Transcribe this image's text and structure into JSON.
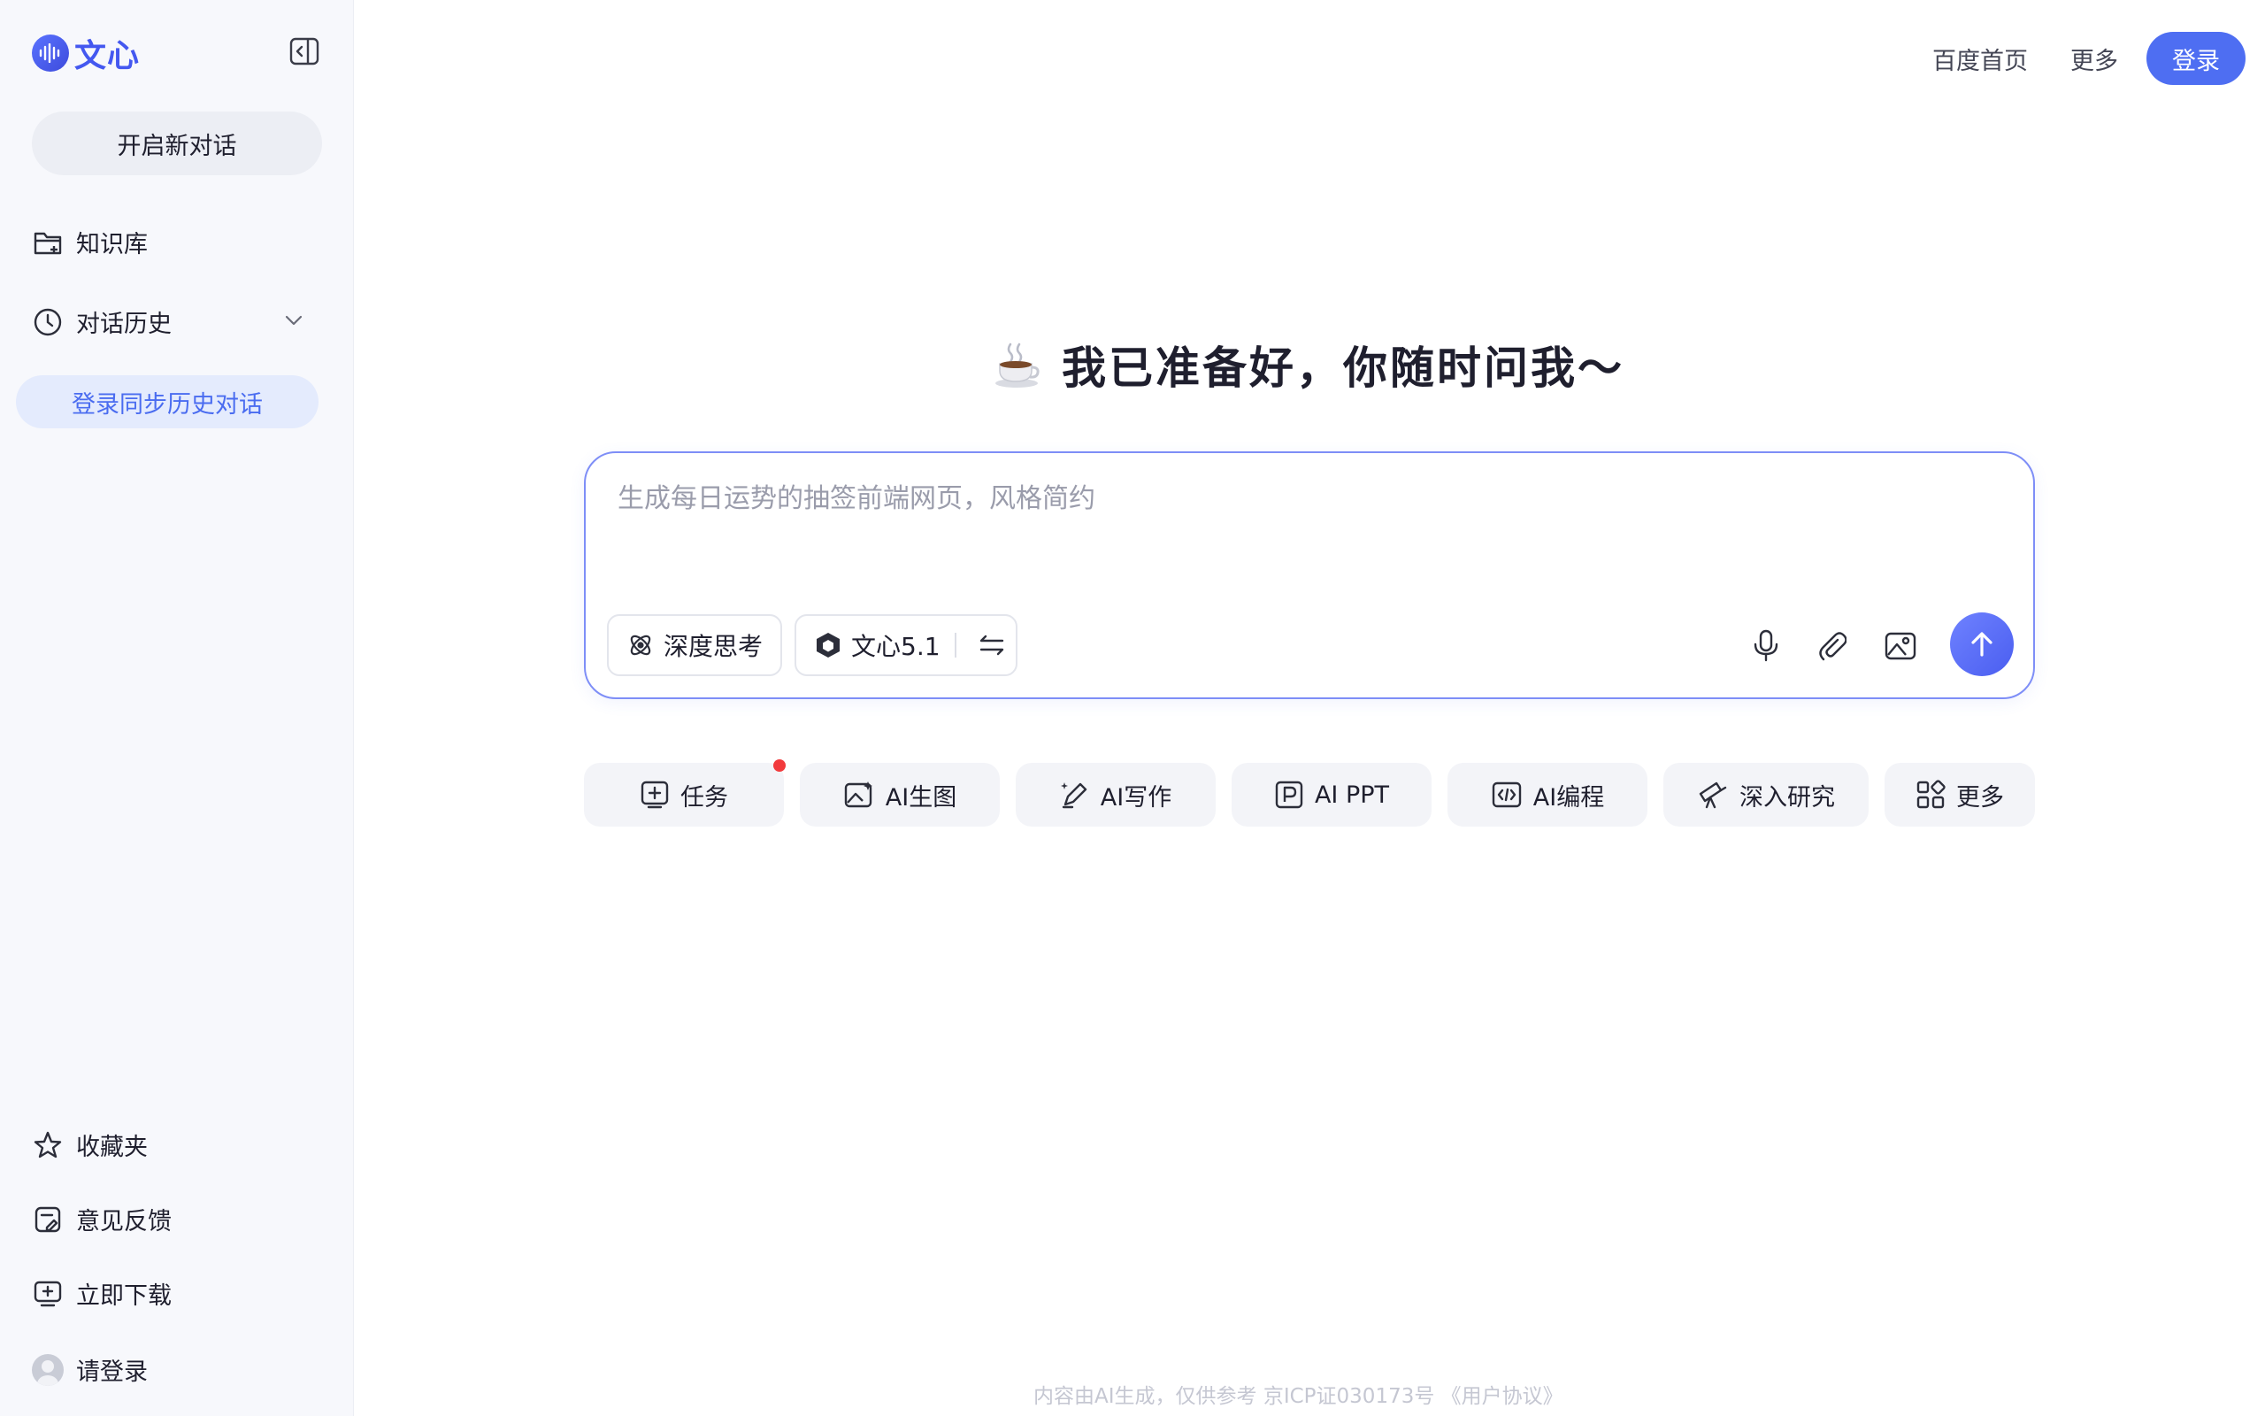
{
  "brand": {
    "logo_text": "文心",
    "accent": "#4e6ef2"
  },
  "sidebar": {
    "new_chat_label": "开启新对话",
    "knowledge_label": "知识库",
    "history_label": "对话历史",
    "login_sync_label": "登录同步历史对话",
    "favorites_label": "收藏夹",
    "feedback_label": "意见反馈",
    "download_label": "立即下载",
    "login_label": "请登录"
  },
  "header": {
    "baidu_home": "百度首页",
    "more": "更多",
    "login": "登录"
  },
  "main": {
    "greeting": "我已准备好，你随时问我～",
    "input_placeholder": "生成每日运势的抽签前端网页，风格简约",
    "deep_think_label": "深度思考",
    "model_label": "文心5.1",
    "chips": [
      {
        "label": "任务",
        "icon": "task-icon"
      },
      {
        "label": "AI生图",
        "icon": "image-gen-icon"
      },
      {
        "label": "AI写作",
        "icon": "pen-icon"
      },
      {
        "label": "AI PPT",
        "icon": "ppt-icon"
      },
      {
        "label": "AI编程",
        "icon": "code-icon"
      },
      {
        "label": "深入研究",
        "icon": "telescope-icon"
      },
      {
        "label": "更多",
        "icon": "grid-icon"
      }
    ]
  },
  "footer": {
    "text": "内容由AI生成，仅供参考  京ICP证030173号  《用户协议》"
  }
}
